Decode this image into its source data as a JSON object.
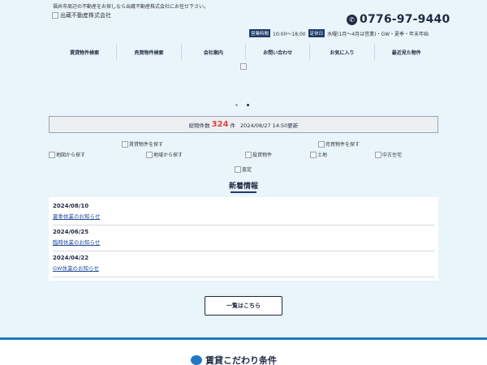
{
  "header": {
    "tagline": "福井市周辺の不動産をお探しなら出蔵不動産株式会社にお任せ下さい。",
    "logo_alt": "出蔵不動産株式会社",
    "phone": "0776-97-9440",
    "hours_label": "営業時間",
    "hours": "10:00～18:00",
    "holiday_label": "定休日",
    "holidays": "水曜(1月〜4月は営業)・GW・夏季・年末年始"
  },
  "nav": [
    {
      "label": "賃貸物件検索"
    },
    {
      "label": "売買物件検索"
    },
    {
      "label": "会社案内"
    },
    {
      "label": "お問い合わせ"
    },
    {
      "label": "お気に入り"
    },
    {
      "label": "最近見た物件"
    }
  ],
  "slider": {
    "dots": 2,
    "active": 2
  },
  "count_bar": {
    "label": "総物件数",
    "count": "324",
    "unit": "件",
    "updated": "2024/08/27 14:50更新"
  },
  "image_links": {
    "rent_search": "賃貸物件を探す",
    "buy_search": "売買物件を探す",
    "map_search": "地図から探す",
    "area_search": "地域から探す",
    "investment": "投資物件",
    "land": "土地",
    "used_house": "中古住宅",
    "appraisal": "査定"
  },
  "news": {
    "title": "新着情報",
    "items": [
      {
        "date": "2024/08/10",
        "text": "夏季休業のお知らせ"
      },
      {
        "date": "2024/06/25",
        "text": "臨時休業のお知らせ"
      },
      {
        "date": "2024/04/22",
        "text": "GW休業のお知らせ"
      }
    ],
    "more_label": "一覧はこちら"
  },
  "rental_conditions": {
    "title": "賃貸こだわり条件"
  },
  "colors": {
    "background": "#e9f5fb",
    "navy": "#1f2a44",
    "accent_blue": "#1f7ac1",
    "count_red": "#e04040"
  }
}
